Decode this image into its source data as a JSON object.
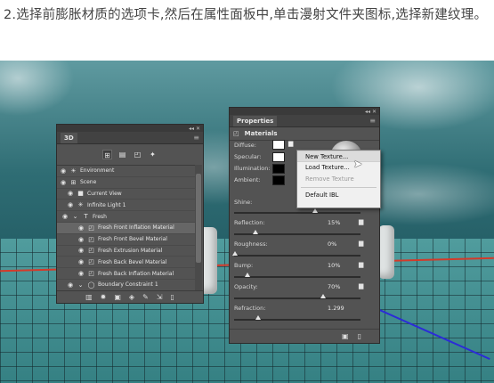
{
  "instruction": "2.选择前膨胀材质的选项卡,然后在属性面板中,单击漫射文件夹图标,选择新建纹理。",
  "panel_3d": {
    "tab": "3D",
    "toolbar_icons": [
      "scene-filter-icon",
      "mesh-filter-icon",
      "material-filter-icon",
      "light-filter-icon"
    ],
    "layers": [
      {
        "label": "Environment",
        "icon": "☀"
      },
      {
        "label": "Scene",
        "icon": "⊞"
      },
      {
        "label": "Current View",
        "icon": "■"
      },
      {
        "label": "Infinite Light 1",
        "icon": "✳"
      },
      {
        "label": "Fresh",
        "icon": "T"
      },
      {
        "label": "Fresh Front Inflation Material",
        "icon": "◰"
      },
      {
        "label": "Fresh Front Bevel Material",
        "icon": "◰"
      },
      {
        "label": "Fresh Extrusion Material",
        "icon": "◰"
      },
      {
        "label": "Fresh Back Bevel Material",
        "icon": "◰"
      },
      {
        "label": "Fresh Back Inflation Material",
        "icon": "◰"
      },
      {
        "label": "Boundary Constraint 1",
        "icon": "◯"
      }
    ]
  },
  "properties": {
    "tab": "Properties",
    "section": "Materials",
    "diffuse_label": "Diffuse:",
    "specular_label": "Specular:",
    "illumination_label": "Illumination:",
    "ambient_label": "Ambient:",
    "shine_label": "Shine:",
    "reflection_label": "Reflection:",
    "reflection_value": "15%",
    "roughness_label": "Roughness:",
    "roughness_value": "0%",
    "bump_label": "Bump:",
    "bump_value": "10%",
    "opacity_label": "Opacity:",
    "opacity_value": "70%",
    "refraction_label": "Refraction:",
    "refraction_value": "1.299",
    "colors": {
      "diffuse": "#ffffff",
      "specular": "#ffffff",
      "illumination": "#000000",
      "ambient": "#000000"
    }
  },
  "menu": {
    "new_texture": "New Texture...",
    "load_texture": "Load Texture...",
    "remove_texture": "Remove Texture",
    "default_ibl": "Default IBL"
  }
}
